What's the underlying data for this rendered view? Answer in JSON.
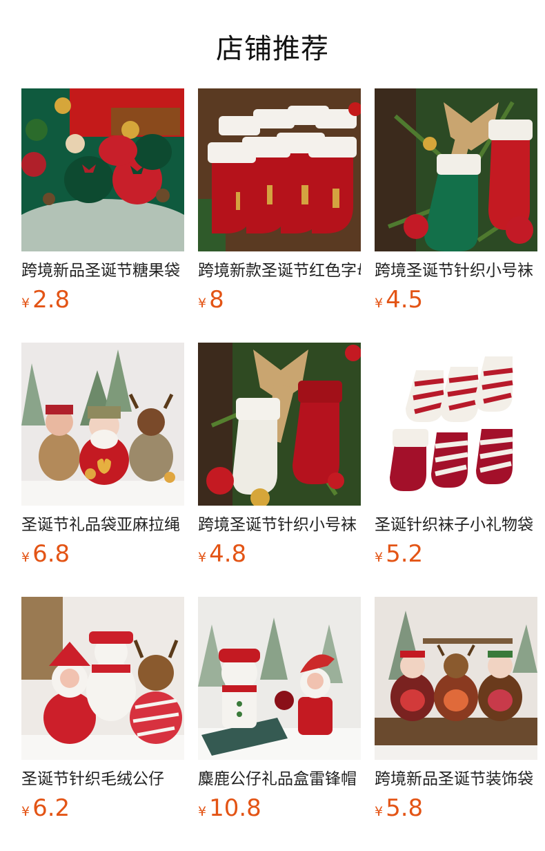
{
  "section_title": "店铺推荐",
  "products": [
    {
      "name": "跨境新品圣诞节糖果袋",
      "currency": "¥",
      "price": "2.8",
      "image": "candy-gift-bags-photo"
    },
    {
      "name": "跨境新款圣诞节红色字母袜",
      "currency": "¥",
      "price": "8",
      "image": "red-letter-stockings-photo"
    },
    {
      "name": "跨境圣诞节针织小号袜",
      "currency": "¥",
      "price": "4.5",
      "image": "knit-stockings-on-tree-photo"
    },
    {
      "name": "圣诞节礼品袋亚麻拉绳",
      "currency": "¥",
      "price": "6.8",
      "image": "linen-gift-bag-dolls-photo"
    },
    {
      "name": "跨境圣诞节针织小号袜",
      "currency": "¥",
      "price": "4.8",
      "image": "white-red-knit-stockings-photo"
    },
    {
      "name": "圣诞针织袜子小礼物袋",
      "currency": "¥",
      "price": "5.2",
      "image": "striped-stockings-photo"
    },
    {
      "name": "圣诞节针织毛绒公仔",
      "currency": "¥",
      "price": "6.2",
      "image": "plush-santa-snowman-reindeer-photo"
    },
    {
      "name": "麋鹿公仔礼品盒雷锋帽",
      "currency": "¥",
      "price": "10.8",
      "image": "snowman-santa-gift-box-photo"
    },
    {
      "name": "跨境新品圣诞节装饰袋",
      "currency": "¥",
      "price": "5.8",
      "image": "sequin-gift-bags-photo"
    }
  ]
}
